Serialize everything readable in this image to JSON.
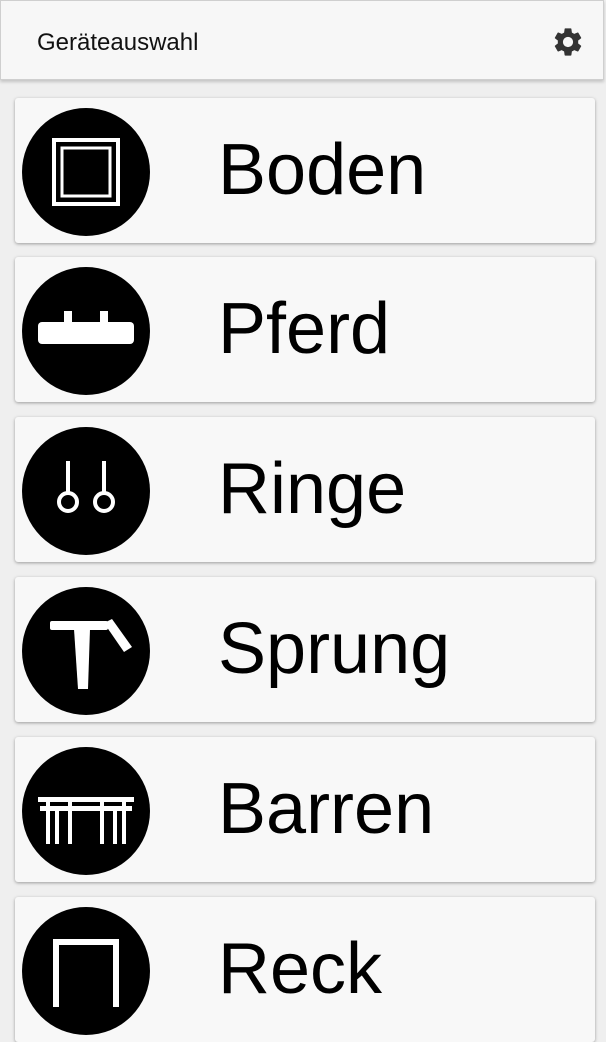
{
  "appbar": {
    "title": "Geräteauswahl",
    "settings_icon": "gear-icon"
  },
  "apparatus": [
    {
      "label": "Boden",
      "icon": "floor-mat-icon"
    },
    {
      "label": "Pferd",
      "icon": "pommel-horse-icon"
    },
    {
      "label": "Ringe",
      "icon": "rings-icon"
    },
    {
      "label": "Sprung",
      "icon": "vault-icon"
    },
    {
      "label": "Barren",
      "icon": "parallel-bars-icon"
    },
    {
      "label": "Reck",
      "icon": "high-bar-icon"
    }
  ],
  "colors": {
    "icon_background": "#000000",
    "icon_foreground": "#ffffff",
    "card_background": "#f8f8f8",
    "page_background": "#efefef"
  }
}
